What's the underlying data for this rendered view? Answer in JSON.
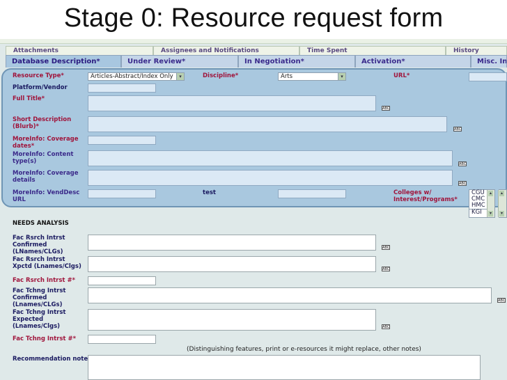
{
  "slide": {
    "title": "Stage 0: Resource request form"
  },
  "back_tabs": [
    "Attachments",
    "Assignees and Notifications",
    "Time Spent",
    "History"
  ],
  "front_tabs": [
    "Database Description*",
    "Under Review*",
    "In Negotiation*",
    "Activation*",
    "Misc. In"
  ],
  "fields": {
    "resource_type": {
      "label": "Resource Type*",
      "value": "Articles-Abstract/Index Only",
      "arrow": "▾"
    },
    "discipline": {
      "label": "Discipline*",
      "value": "Arts",
      "arrow": "▾"
    },
    "url": {
      "label": "URL*",
      "value": ""
    },
    "platform_vendor": {
      "label": "Platform/Vendor",
      "value": ""
    },
    "full_title": {
      "label": "Full Title*",
      "value": ""
    },
    "short_description": {
      "label": "Short Description (Blurb)*",
      "value": ""
    },
    "coverage_dates": {
      "label": "MoreInfo: Coverage dates*",
      "value": ""
    },
    "content_types": {
      "label": "MoreInfo: Content type(s)",
      "value": ""
    },
    "coverage_details": {
      "label": "MoreInfo: Coverage details",
      "value": ""
    },
    "vend_desc_url": {
      "label": "MoreInfo: VendDesc URL",
      "value": ""
    },
    "test_label": "test",
    "colleges": {
      "label": "Colleges w/ Interest/Programs*",
      "options": [
        "CGU",
        "CMC",
        "HMC",
        "KGI"
      ],
      "up": "▴",
      "down": "▾"
    }
  },
  "needs_analysis": {
    "heading": "NEEDS ANALYSIS",
    "fac_rsrch_confirmed": "Fac Rsrch Intrst Confirmed (LNames/CLGs)",
    "fac_rsrch_expected": "Fac Rsrch Intrst Xpctd (Lnames/Clgs)",
    "fac_rsrch_count": "Fac Rsrch Intrst #*",
    "fac_tchng_confirmed": "Fac Tchng Intrst Confirmed (Lnames/CLGs)",
    "fac_tchng_expected": "Fac Tchng Intrst Expected (Lnames/Clgs)",
    "fac_tchng_count": "Fac Tchng Intrst #*",
    "distinguishing_note": "(Distinguishing features, print or e-resources it might replace, other notes)",
    "recommendation_notes": "Recommendation notes"
  },
  "spell_icon_text": "ABC",
  "colors": {
    "panel": "#a9c8df",
    "panel_border": "#6f95b5",
    "background": "#dfe9e9",
    "required_label": "#a0153c",
    "label": "#1a1a60"
  }
}
